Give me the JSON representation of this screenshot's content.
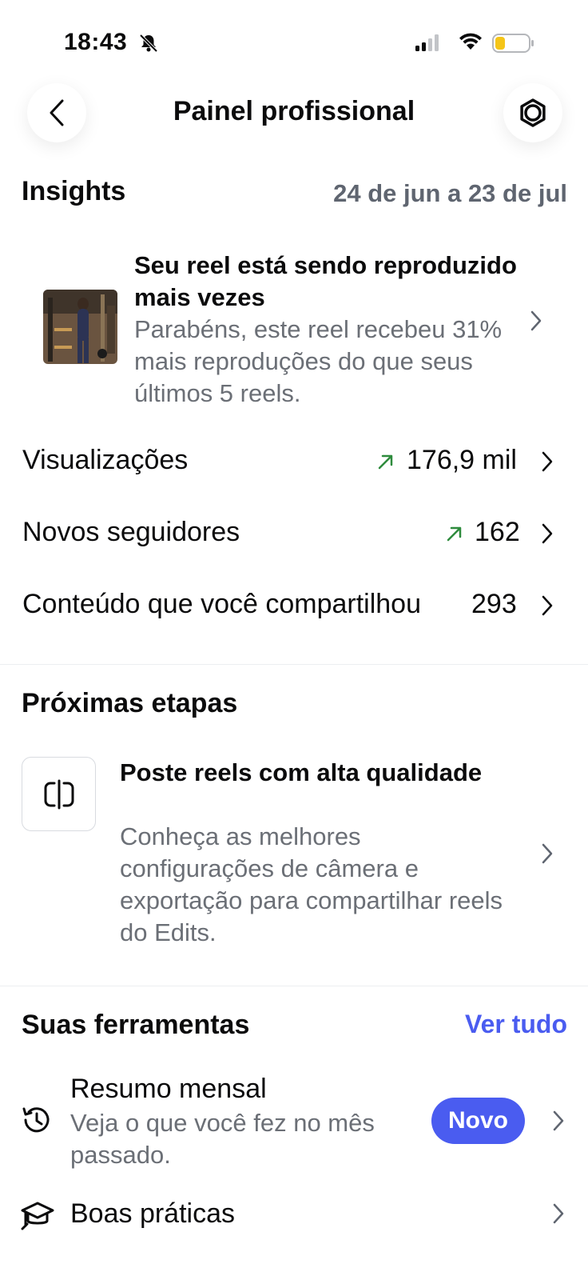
{
  "status_bar": {
    "time": "18:43",
    "bell_icon": "bell-slash-icon"
  },
  "header": {
    "title": "Painel profissional"
  },
  "insights": {
    "title": "Insights",
    "date_range": "24 de jun a 23 de jul",
    "reel_card": {
      "title": "Seu reel está sendo reproduzido mais vezes",
      "description": "Parabéns, este reel recebeu 31% mais reproduções do que seus últimos 5 reels."
    },
    "metrics": [
      {
        "label": "Visualizações",
        "value": "176,9 mil",
        "trend": "up"
      },
      {
        "label": "Novos seguidores",
        "value": "162",
        "trend": "up"
      },
      {
        "label": "Conteúdo que você compartilhou",
        "value": "293",
        "trend": ""
      }
    ]
  },
  "next_steps": {
    "title": "Próximas etapas",
    "card": {
      "title": "Poste reels com alta qualidade",
      "description": "Conheça as melhores configurações de câmera e exportação para compartilhar reels do Edits."
    }
  },
  "tools": {
    "title": "Suas ferramentas",
    "see_all": "Ver tudo",
    "items": [
      {
        "title": "Resumo mensal",
        "description": "Veja o que você fez no mês passado.",
        "badge": "Novo"
      },
      {
        "title": "Boas práticas"
      }
    ]
  },
  "colors": {
    "accent": "#4a5cf0",
    "trend_up": "#2e8b3d",
    "secondary_text": "#6b6f76"
  }
}
